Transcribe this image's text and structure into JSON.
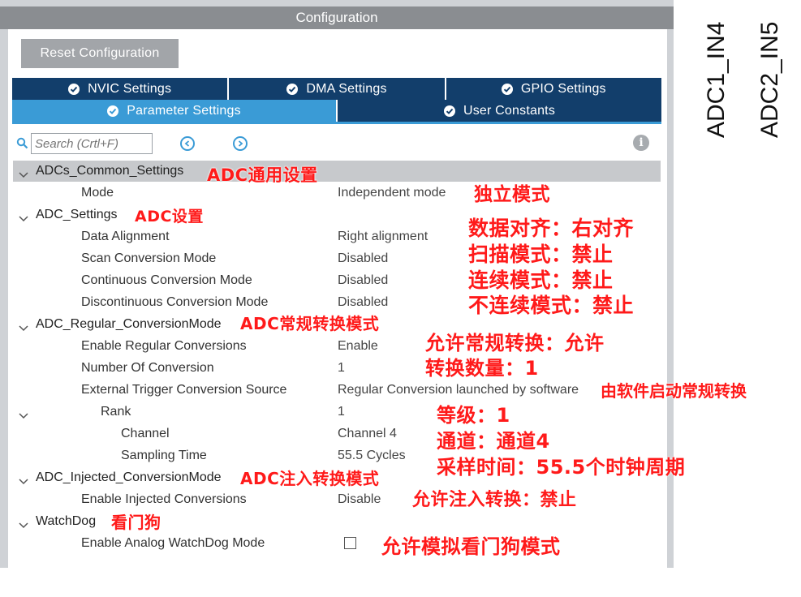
{
  "window": {
    "title": "Configuration"
  },
  "toolbar": {
    "reset_label": "Reset Configuration"
  },
  "tabs": {
    "row1": [
      {
        "label": "NVIC Settings"
      },
      {
        "label": "DMA Settings"
      },
      {
        "label": "GPIO Settings"
      }
    ],
    "row2": [
      {
        "label": "Parameter Settings",
        "active": true
      },
      {
        "label": "User Constants"
      }
    ]
  },
  "search": {
    "placeholder": "Search (Crtl+F)"
  },
  "tree": {
    "common": {
      "label": "ADCs_Common_Settings",
      "mode": {
        "label": "Mode",
        "value": "Independent mode"
      }
    },
    "adc_settings": {
      "label": "ADC_Settings",
      "items": [
        {
          "label": "Data Alignment",
          "value": "Right alignment"
        },
        {
          "label": "Scan Conversion Mode",
          "value": "Disabled"
        },
        {
          "label": "Continuous Conversion Mode",
          "value": "Disabled"
        },
        {
          "label": "Discontinuous Conversion Mode",
          "value": "Disabled"
        }
      ]
    },
    "regular": {
      "label": "ADC_Regular_ConversionMode",
      "items": [
        {
          "label": "Enable Regular Conversions",
          "value": "Enable"
        },
        {
          "label": "Number Of Conversion",
          "value": "1"
        },
        {
          "label": "External Trigger Conversion Source",
          "value": "Regular Conversion launched by software"
        }
      ],
      "rank": {
        "label": "Rank",
        "value": "1",
        "channel": {
          "label": "Channel",
          "value": "Channel 4"
        },
        "sampling": {
          "label": "Sampling Time",
          "value": "55.5 Cycles"
        }
      }
    },
    "injected": {
      "label": "ADC_Injected_ConversionMode",
      "items": [
        {
          "label": "Enable Injected Conversions",
          "value": "Disable"
        }
      ]
    },
    "watchdog": {
      "label": "WatchDog",
      "items": [
        {
          "label": "Enable Analog WatchDog Mode",
          "checked": false
        }
      ]
    }
  },
  "annotations": {
    "common": "ADC通用设置",
    "mode": "独立模式",
    "adc_settings": "ADC设置",
    "data_alignment": "数据对齐：右对齐",
    "scan": "扫描模式：禁止",
    "continuous": "连续模式：禁止",
    "discontinuous": "不连续模式：禁止",
    "regular": "ADC常规转换模式",
    "enable_regular": "允许常规转换：允许",
    "num_conversion": "转换数量：1",
    "ext_trigger": "由软件启动常规转换",
    "rank": "等级：1",
    "channel": "通道：通道4",
    "sampling": "采样时间：55.5个时钟周期",
    "injected": "ADC注入转换模式",
    "enable_injected": "允许注入转换：禁止",
    "watchdog": "看门狗",
    "analog_watchdog": "允许模拟看门狗模式"
  },
  "side_labels": [
    "ADC1_IN4",
    "ADC2_IN5"
  ],
  "colors": {
    "tab_dark": "#123e6b",
    "tab_active": "#3a9bd6",
    "annotation": "#ff1a1a"
  }
}
